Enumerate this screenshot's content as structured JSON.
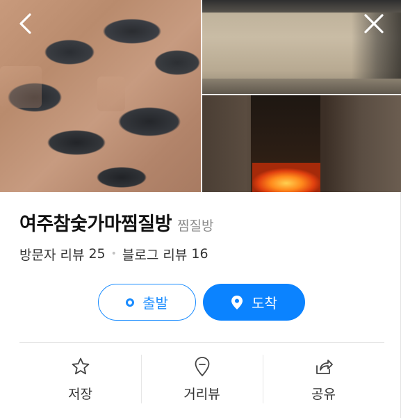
{
  "place": {
    "name": "여주참숯가마찜질방",
    "category": "찜질방"
  },
  "reviews": {
    "visitor_label": "방문자 리뷰",
    "visitor_count": "25",
    "separator": "•",
    "blog_label": "블로그 리뷰",
    "blog_count": "16"
  },
  "actions": {
    "depart_label": "출발",
    "arrive_label": "도착"
  },
  "bottom_bar": {
    "items": [
      {
        "label": "저장",
        "icon": "star-icon"
      },
      {
        "label": "거리뷰",
        "icon": "map-pin-outline-icon"
      },
      {
        "label": "공유",
        "icon": "share-icon"
      }
    ]
  },
  "gallery": {
    "photos": [
      "charcoal-sacks",
      "kiln-wall",
      "kiln-fire"
    ]
  },
  "colors": {
    "accent": "#0b83ff",
    "accent_outline": "#1a8cff",
    "title": "#111111",
    "muted": "#8a8a8a"
  }
}
